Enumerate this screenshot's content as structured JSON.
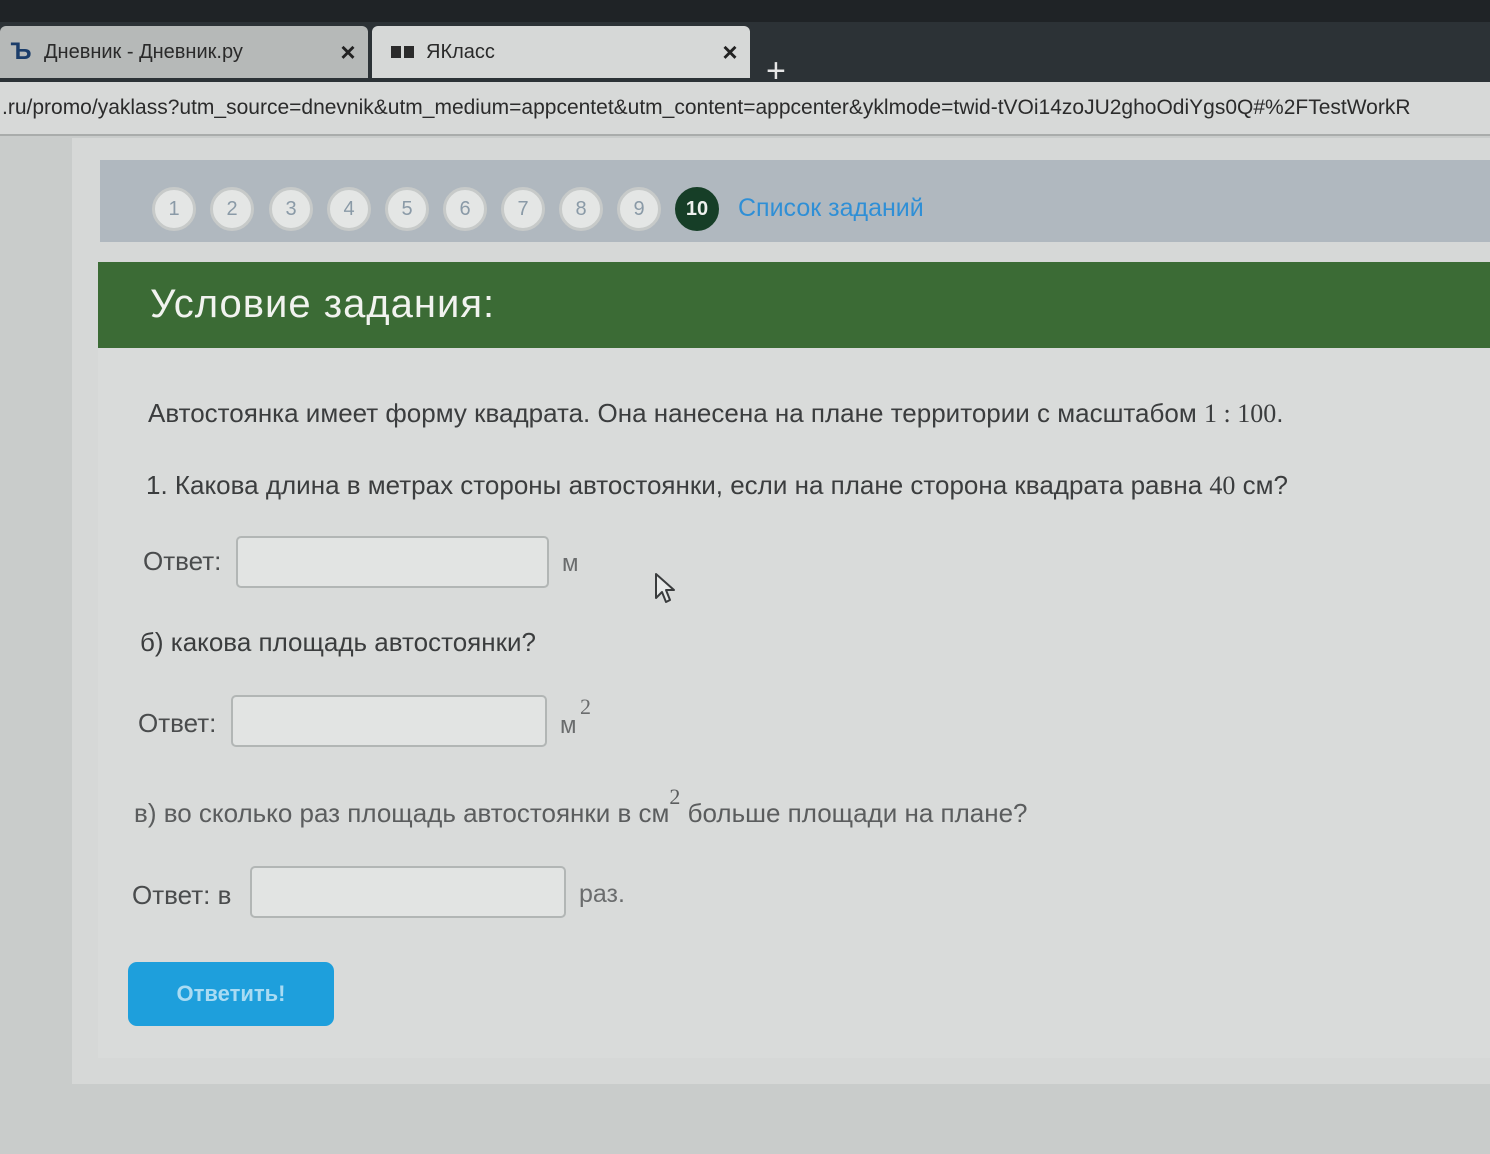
{
  "browser": {
    "tabs": [
      {
        "title": "Дневник - Дневник.ру",
        "favicon": "dnevnik-logo-icon",
        "active": false
      },
      {
        "title": "ЯКласс",
        "favicon": "yaklass-book-icon",
        "active": true
      }
    ],
    "new_tab_label": "+",
    "close_glyph": "×",
    "url": ".ru/promo/yaklass?utm_source=dnevnik&utm_medium=appcentet&utm_content=appcenter&yklmode=twid-tVOi14zoJU2ghoOdiYgs0Q#%2FTestWorkR"
  },
  "nav": {
    "questions": [
      "1",
      "2",
      "3",
      "4",
      "5",
      "6",
      "7",
      "8",
      "9",
      "10"
    ],
    "active_question": "10",
    "task_list_link": "Список заданий"
  },
  "task": {
    "header": "Условие задания:",
    "intro_text": "Автостоянка имеет форму квадрата. Она нанесена на плане территории с масштабом ",
    "intro_scale": "1 : 100",
    "intro_end": ".",
    "q1_text": "1. Какова длина в метрах стороны автостоянки, если на плане сторона квадрата равна ",
    "q1_value": "40",
    "q1_unit": " см?",
    "answer1_label": "Ответ:",
    "answer1_unit": "м",
    "q2_text": "б) какова площадь автостоянки?",
    "answer2_label": "Ответ:",
    "answer2_unit": "м",
    "answer2_unit_sup": "2",
    "q3_text_before": "в) во сколько раз площадь автостоянки в см",
    "q3_sup": "2",
    "q3_text_after": " больше площади на плане?",
    "answer3_label": "Ответ: в",
    "answer3_unit": "раз.",
    "submit_label": "Ответить!"
  },
  "colors": {
    "header_green": "#3b6b35",
    "active_circle": "#163e27",
    "link_blue": "#2f8fd6",
    "button_blue": "#1e9fdc"
  }
}
